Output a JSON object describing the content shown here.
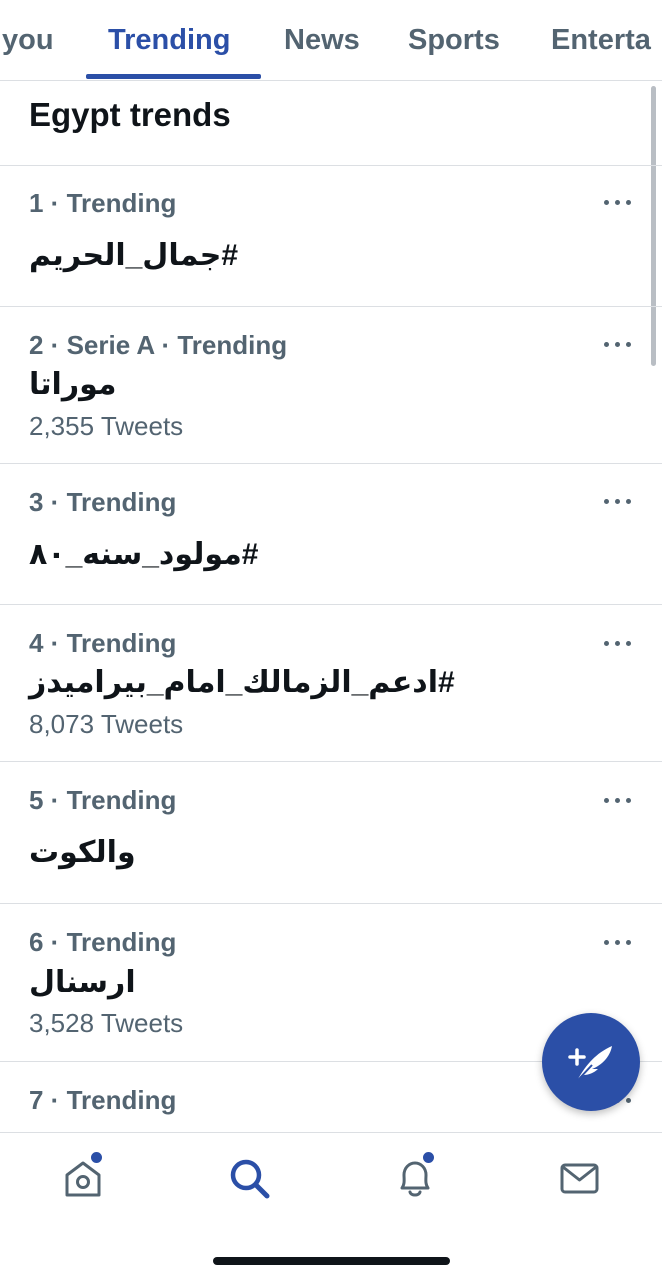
{
  "tabs": [
    {
      "label": "you",
      "active": false
    },
    {
      "label": "Trending",
      "active": true
    },
    {
      "label": "News",
      "active": false
    },
    {
      "label": "Sports",
      "active": false
    },
    {
      "label": "Enterta",
      "active": false
    }
  ],
  "section_title": "Egypt trends",
  "trends": [
    {
      "meta": "1 · Trending",
      "name": "#جمال_الحريم",
      "count": ""
    },
    {
      "meta": "2 · Serie A · Trending",
      "name": "موراتا",
      "count": "2,355 Tweets"
    },
    {
      "meta": "3 · Trending",
      "name": "#مولود_سنه_٨٠",
      "count": ""
    },
    {
      "meta": "4 · Trending",
      "name": "#ادعم_الزمالك_امام_بيراميدز",
      "count": "8,073 Tweets"
    },
    {
      "meta": "5 · Trending",
      "name": "والكوت",
      "count": ""
    },
    {
      "meta": "6 · Trending",
      "name": "ارسنال",
      "count": "3,528 Tweets"
    },
    {
      "meta": "7 · Trending",
      "name": "",
      "count": ""
    }
  ],
  "icons": {
    "more": "more-horizontal-icon",
    "compose": "compose-tweet-icon",
    "home": "home-icon",
    "search": "search-icon",
    "notifications": "bell-icon",
    "messages": "mail-icon"
  },
  "colors": {
    "accent": "#2b4fa7",
    "text_primary": "#0f1419",
    "text_secondary": "#536471",
    "divider": "#dcdfe3"
  },
  "badges": {
    "home_unread": true,
    "notifications_unread": true
  }
}
